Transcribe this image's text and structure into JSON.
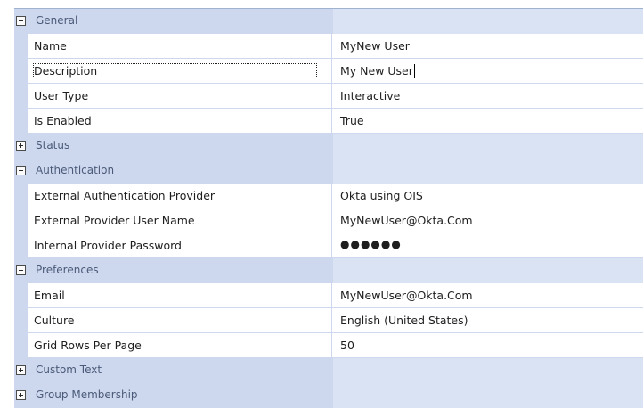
{
  "categories": [
    {
      "label": "General",
      "expanded": true,
      "properties": [
        {
          "name": "Name",
          "value": "MyNew User"
        },
        {
          "name": "Description",
          "value": "My New User",
          "focused": true,
          "editing": true
        },
        {
          "name": "User Type",
          "value": "Interactive"
        },
        {
          "name": "Is Enabled",
          "value": "True"
        }
      ]
    },
    {
      "label": "Status",
      "expanded": false,
      "properties": []
    },
    {
      "label": "Authentication",
      "expanded": true,
      "properties": [
        {
          "name": "External Authentication Provider",
          "value": "Okta using OIS"
        },
        {
          "name": "External Provider User Name",
          "value": "MyNewUser@Okta.Com"
        },
        {
          "name": "Internal Provider Password",
          "value": "●●●●●●",
          "password": true
        }
      ]
    },
    {
      "label": "Preferences",
      "expanded": true,
      "properties": [
        {
          "name": "Email",
          "value": "MyNewUser@Okta.Com"
        },
        {
          "name": "Culture",
          "value": "English (United States)"
        },
        {
          "name": "Grid Rows Per Page",
          "value": "50"
        }
      ]
    },
    {
      "label": "Custom Text",
      "expanded": false,
      "properties": []
    },
    {
      "label": "Group Membership",
      "expanded": false,
      "properties": []
    }
  ]
}
